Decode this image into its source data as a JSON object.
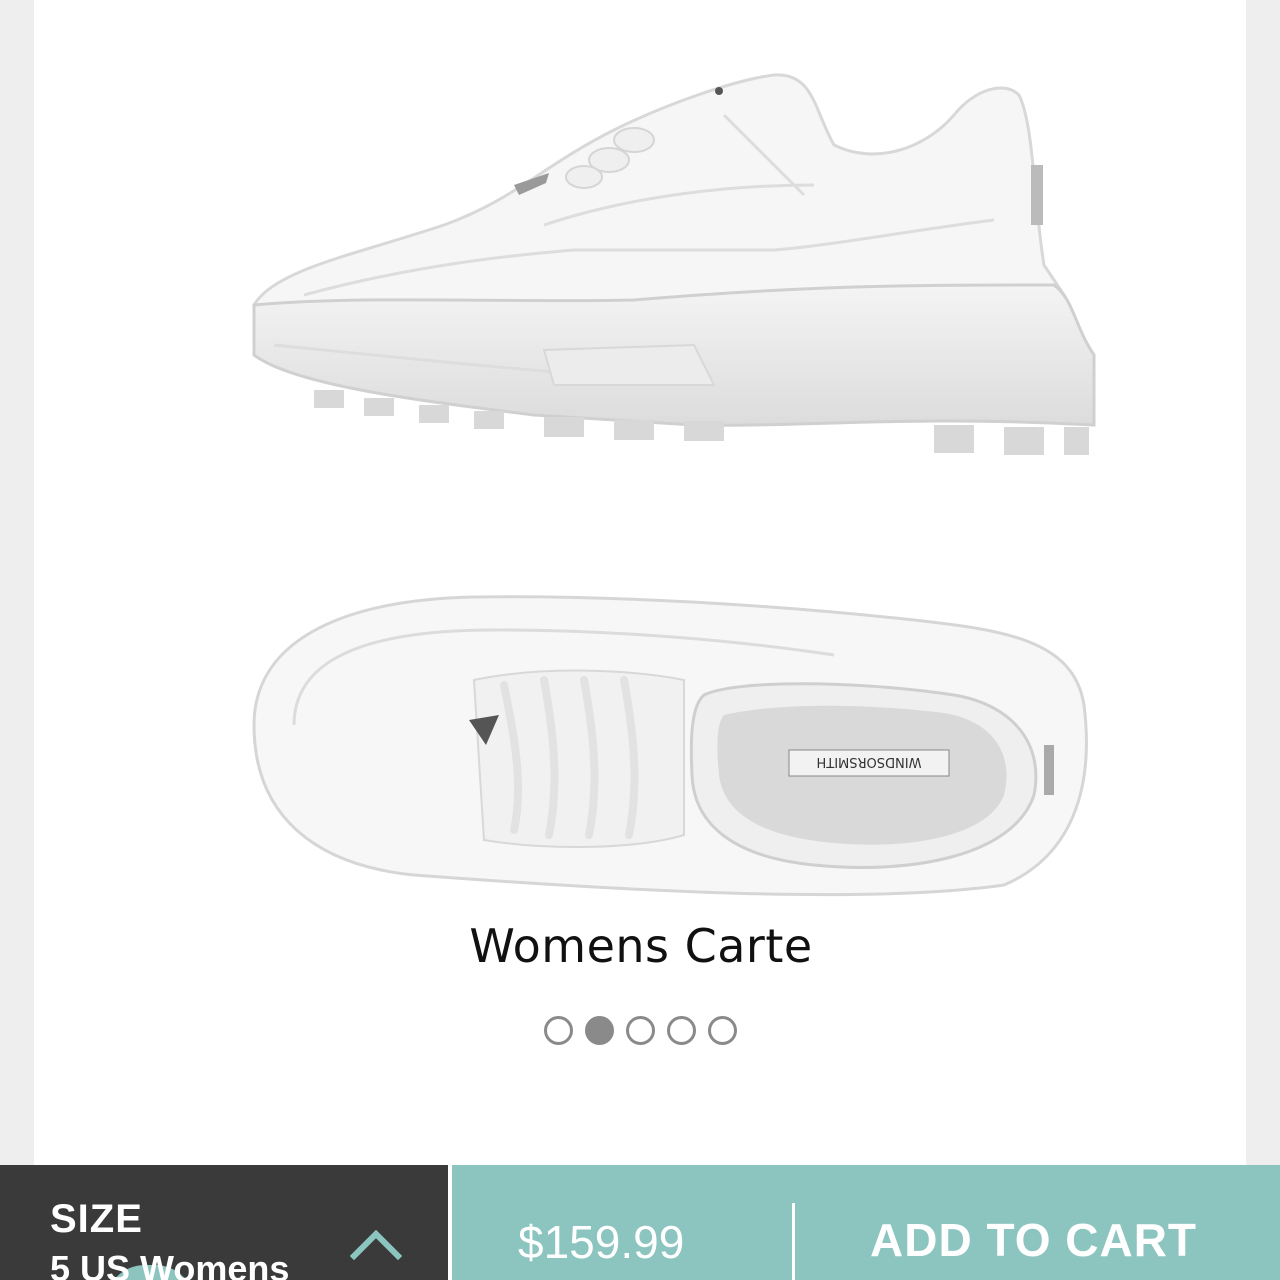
{
  "product": {
    "name": "Womens Carte",
    "insole_brand": "WINDSORSMITH"
  },
  "carousel": {
    "count": 5,
    "active_index": 1
  },
  "purchase_bar": {
    "size_heading": "SIZE",
    "size_value": "5 US Womens",
    "price": "$159.99",
    "add_to_cart_label": "ADD TO CART"
  },
  "colors": {
    "accent": "#8cc5c0",
    "dark_panel": "#3a3a3a",
    "dot": "#8a8a8a"
  },
  "icons": {
    "size_toggle": "chevron-up-icon"
  }
}
